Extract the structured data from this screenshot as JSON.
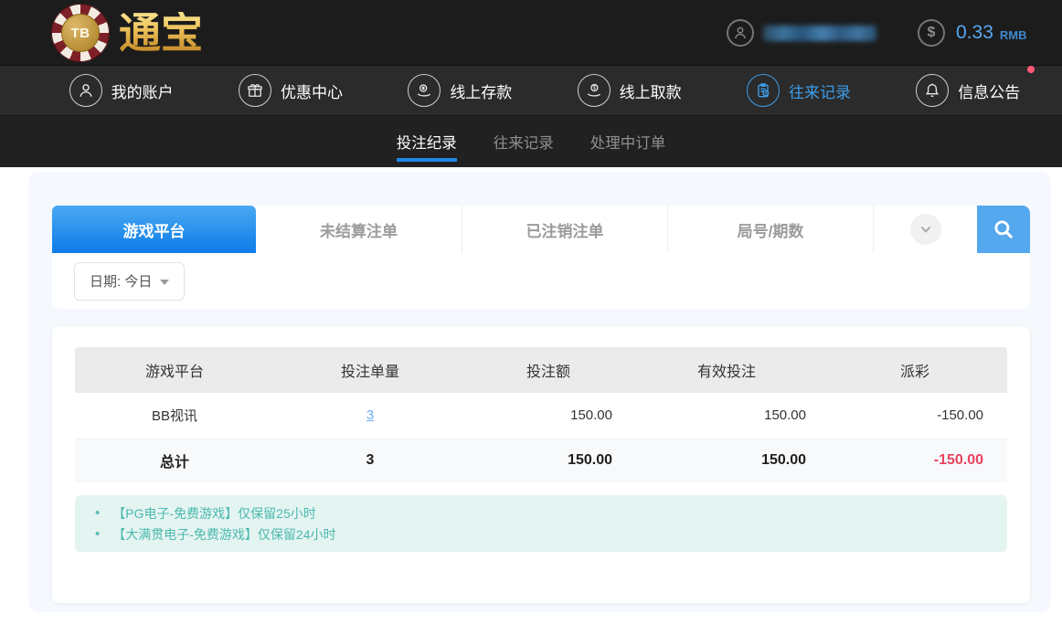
{
  "header": {
    "chip_text": "TB",
    "brand": "通宝",
    "balance": "0.33",
    "currency": "RMB"
  },
  "nav": {
    "items": [
      {
        "label": "我的账户",
        "icon": "user-icon",
        "active": false
      },
      {
        "label": "优惠中心",
        "icon": "gift-icon",
        "active": false
      },
      {
        "label": "线上存款",
        "icon": "deposit-icon",
        "active": false
      },
      {
        "label": "线上取款",
        "icon": "withdraw-icon",
        "active": false
      },
      {
        "label": "往来记录",
        "icon": "records-icon",
        "active": true
      },
      {
        "label": "信息公告",
        "icon": "bell-icon",
        "active": false,
        "badge": true
      }
    ]
  },
  "subnav": {
    "items": [
      {
        "label": "投注纪录",
        "active": true
      },
      {
        "label": "往来记录",
        "active": false
      },
      {
        "label": "处理中订单",
        "active": false
      }
    ]
  },
  "filters": {
    "tabs": [
      {
        "label": "游戏平台",
        "active": true
      },
      {
        "label": "未结算注单",
        "active": false
      },
      {
        "label": "已注销注单",
        "active": false
      },
      {
        "label": "局号/期数",
        "active": false
      }
    ],
    "dropdown_icon": "chevron-down-icon",
    "search_icon": "search-icon",
    "date_label": "日期: 今日"
  },
  "table": {
    "columns": [
      "游戏平台",
      "投注单量",
      "投注额",
      "有效投注",
      "派彩"
    ],
    "rows": [
      {
        "platform": "BB视讯",
        "bet_count": "3",
        "bet_amount": "150.00",
        "valid_amount": "150.00",
        "payout": "-150.00"
      }
    ],
    "total": {
      "label": "总计",
      "bet_count": "3",
      "bet_amount": "150.00",
      "valid_amount": "150.00",
      "payout": "-150.00"
    }
  },
  "notes": [
    "【PG电子-免费游戏】仅保留25小时",
    "【大满贯电子-免费游戏】仅保留24小时"
  ],
  "colors": {
    "accent_blue": "#1e88e5",
    "active_tab_gradient_top": "#4aa9f2",
    "active_tab_gradient_bottom": "#0d7ce9",
    "search_button": "#54a9ee",
    "nav_active": "#3d9ce8",
    "negative": "#f0566f",
    "link": "#6cb1f4",
    "note_text": "#4bb9ae",
    "balance_text": "#57a8f2",
    "badge": "#ff5a78",
    "brand_gold": "#e9bd55"
  }
}
